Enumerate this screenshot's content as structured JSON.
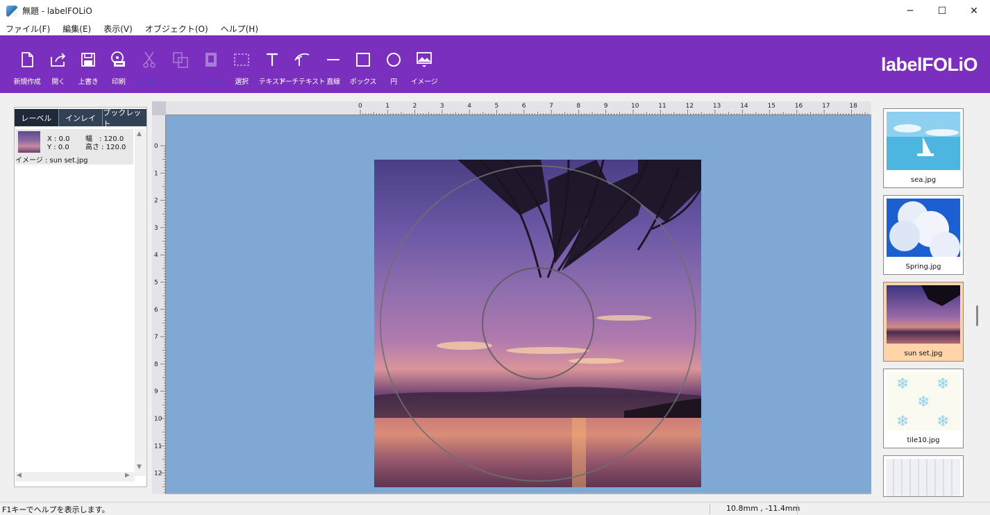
{
  "window": {
    "title": "無題 - labelFOLiO",
    "minimize": "─",
    "maximize": "☐",
    "close": "✕"
  },
  "menu": [
    "ファイル(F)",
    "編集(E)",
    "表示(V)",
    "オブジェクト(O)",
    "ヘルプ(H)"
  ],
  "toolbar": {
    "tools": [
      {
        "label": "新規作成",
        "icon": "new-document-icon",
        "enabled": true
      },
      {
        "label": "開く",
        "icon": "open-icon",
        "enabled": true
      },
      {
        "label": "上書き",
        "icon": "save-icon",
        "enabled": true
      },
      {
        "label": "印刷",
        "icon": "print-icon",
        "enabled": true
      },
      {
        "label": "切り取り",
        "icon": "cut-icon",
        "enabled": false
      },
      {
        "label": "コピー",
        "icon": "copy-icon",
        "enabled": false
      },
      {
        "label": "貼り付け",
        "icon": "paste-icon",
        "enabled": false
      },
      {
        "label": "選択",
        "icon": "select-icon",
        "enabled": true
      },
      {
        "label": "テキスト",
        "icon": "text-icon",
        "enabled": true
      },
      {
        "label": "アーチテキスト",
        "icon": "arch-text-icon",
        "enabled": true
      },
      {
        "label": "直線",
        "icon": "line-icon",
        "enabled": true
      },
      {
        "label": "ボックス",
        "icon": "box-icon",
        "enabled": true
      },
      {
        "label": "円",
        "icon": "circle-icon",
        "enabled": true
      },
      {
        "label": "イメージ",
        "icon": "image-icon",
        "enabled": true
      }
    ],
    "logo": "labelFOLiO"
  },
  "left_panel": {
    "tabs": [
      "レーベル",
      "インレイ",
      "ブックレット"
    ],
    "active_tab": "レーベル",
    "object": {
      "x": "X : 0.0",
      "y": "Y : 0.0",
      "width": "幅　: 120.0",
      "height": "高さ : 120.0",
      "name": "イメージ : sun set.jpg"
    }
  },
  "ruler": {
    "top": [
      "0",
      "1",
      "2",
      "3",
      "4",
      "5",
      "6",
      "7",
      "8",
      "9",
      "10",
      "11",
      "12",
      "13",
      "14",
      "15",
      "16",
      "17",
      "18"
    ],
    "left": [
      "0",
      "1",
      "2",
      "3",
      "4",
      "5",
      "6",
      "7",
      "8",
      "9",
      "10",
      "11",
      "12"
    ]
  },
  "gallery": [
    {
      "caption": "sea.jpg",
      "selected": false
    },
    {
      "caption": "Spring.jpg",
      "selected": false
    },
    {
      "caption": "sun set.jpg",
      "selected": true
    },
    {
      "caption": "tile10.jpg",
      "selected": false
    },
    {
      "caption": "",
      "selected": false
    }
  ],
  "status": {
    "help": "F1キーでヘルプを表示します。",
    "coords": "10.8mm , -11.4mm"
  },
  "colors": {
    "toolbar": "#7b2fbe",
    "canvas": "#7fa8d4",
    "selected_thumb": "#ffd4a8"
  }
}
